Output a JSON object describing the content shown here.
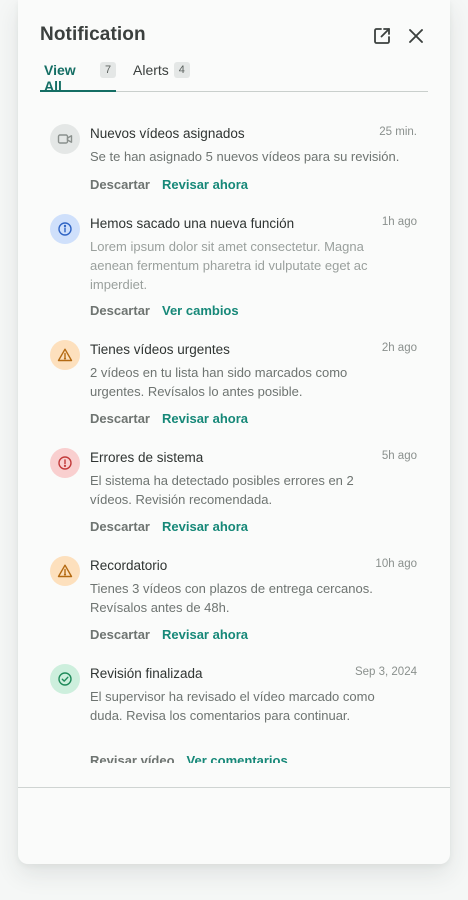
{
  "header": {
    "title": "Notification"
  },
  "tabs": [
    {
      "label": "View All",
      "count": "7",
      "active": true
    },
    {
      "label": "Alerts",
      "count": "4",
      "active": false
    }
  ],
  "icons": {
    "open_external": "open-external-icon",
    "close": "close-icon"
  },
  "colors": {
    "accent": "#146e64",
    "action_primary": "#168878",
    "icon_gray_bg": "#e4e7e6",
    "icon_blue_bg": "#cfe0fb",
    "icon_orange_bg": "#fde0bd",
    "icon_red_bg": "#f9cfcf",
    "icon_green_bg": "#cdefdd"
  },
  "notifications": [
    {
      "icon": "video-camera-icon",
      "title": "Nuevos vídeos asignados",
      "time": "25 min.",
      "body": "Se te han asignado 5 nuevos vídeos para su revisión.",
      "dismiss": "Descartar",
      "primary": "Revisar ahora"
    },
    {
      "icon": "info-icon",
      "title": "Hemos sacado una nueva función",
      "time": "1h ago",
      "body": "Lorem ipsum dolor sit amet consectetur. Magna aenean fermentum pharetra id vulputate eget ac imperdiet.",
      "dismiss": "Descartar",
      "primary": "Ver cambios"
    },
    {
      "icon": "warning-icon",
      "title": "Tienes vídeos urgentes",
      "time": "2h ago",
      "body": "2 vídeos en tu lista han sido marcados como urgentes. Revísalos lo antes posible.",
      "dismiss": "Descartar",
      "primary": "Revisar ahora"
    },
    {
      "icon": "error-icon",
      "title": "Errores de sistema",
      "time": "5h ago",
      "body": "El sistema ha detectado posibles errores en 2 vídeos. Revisión recomendada.",
      "dismiss": "Descartar",
      "primary": "Revisar ahora"
    },
    {
      "icon": "warning-icon",
      "title": "Recordatorio",
      "time": "10h ago",
      "body": "Tienes 3 vídeos con plazos de entrega cercanos. Revísalos antes de 48h.",
      "dismiss": "Descartar",
      "primary": "Revisar ahora"
    },
    {
      "icon": "check-circle-icon",
      "title": "Revisión finalizada",
      "time": "Sep 3, 2024",
      "body": "El supervisor ha revisado el vídeo marcado como duda. Revisa los comentarios para continuar.",
      "dismiss": "Revisar vídeo",
      "primary": "Ver comentarios"
    }
  ]
}
